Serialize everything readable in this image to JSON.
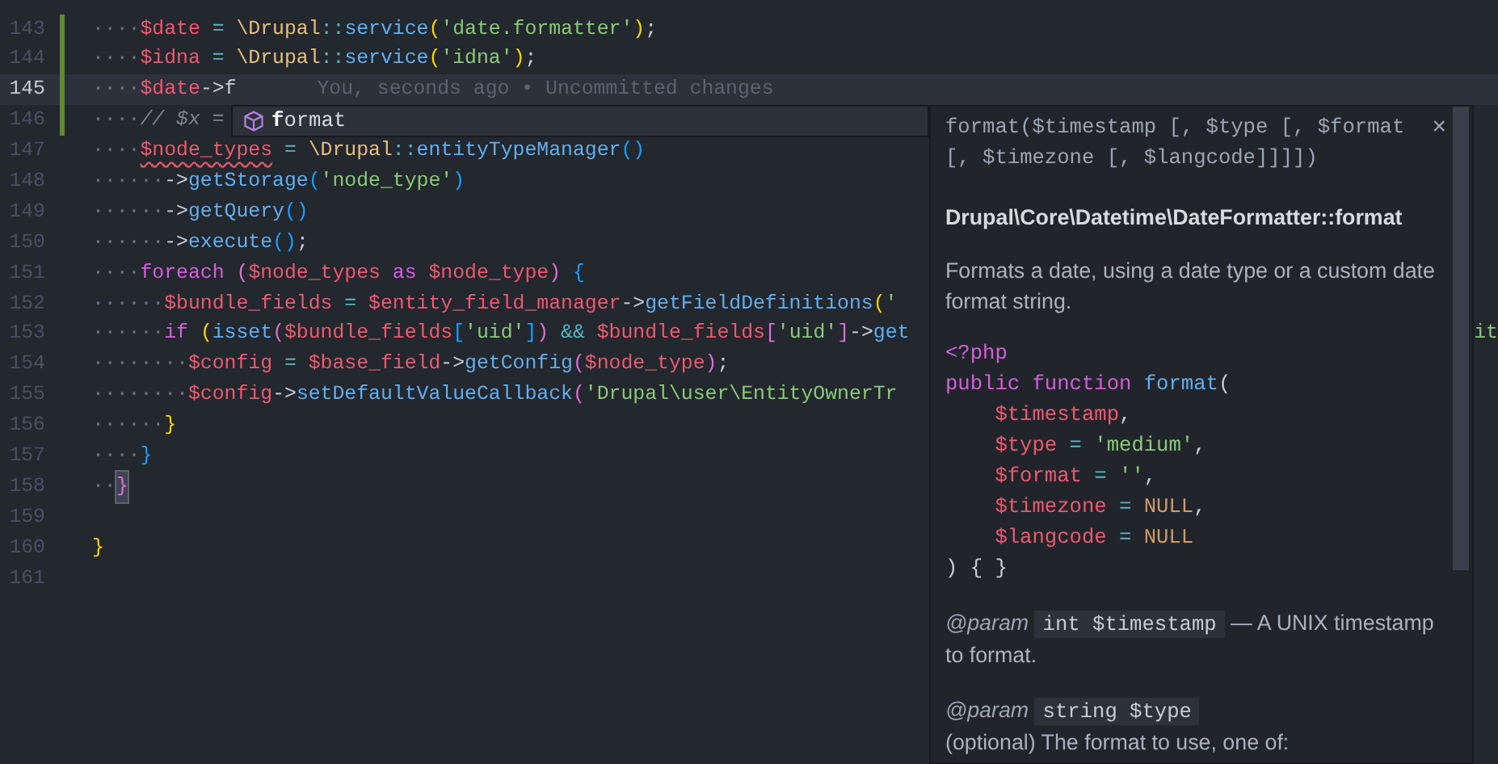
{
  "editor": {
    "lines": [
      {
        "number": "143",
        "modified": true,
        "tokens": [
          {
            "text": "····",
            "kind": "ws"
          },
          {
            "text": "$date",
            "kind": "var"
          },
          {
            "text": " = ",
            "kind": "op"
          },
          {
            "text": "\\Drupal",
            "kind": "cls"
          },
          {
            "text": "::",
            "kind": "op"
          },
          {
            "text": "service",
            "kind": "fn"
          },
          {
            "text": "(",
            "kind": "b1"
          },
          {
            "text": "'date.formatter'",
            "kind": "str"
          },
          {
            "text": ")",
            "kind": "b1"
          },
          {
            "text": ";",
            "kind": "punc"
          }
        ]
      },
      {
        "number": "144",
        "modified": true,
        "tokens": [
          {
            "text": "····",
            "kind": "ws"
          },
          {
            "text": "$idna",
            "kind": "var"
          },
          {
            "text": " = ",
            "kind": "op"
          },
          {
            "text": "\\Drupal",
            "kind": "cls"
          },
          {
            "text": "::",
            "kind": "op"
          },
          {
            "text": "service",
            "kind": "fn"
          },
          {
            "text": "(",
            "kind": "b1"
          },
          {
            "text": "'idna'",
            "kind": "str"
          },
          {
            "text": ")",
            "kind": "b1"
          },
          {
            "text": ";",
            "kind": "punc"
          }
        ]
      },
      {
        "number": "145",
        "modified": true,
        "current": true,
        "tokens": [
          {
            "text": "····",
            "kind": "ws"
          },
          {
            "text": "$date",
            "kind": "var"
          },
          {
            "text": "->f",
            "kind": "punc"
          }
        ],
        "annotation": "You, seconds ago • Uncommitted changes"
      },
      {
        "number": "146",
        "modified": true,
        "tokens": [
          {
            "text": "····",
            "kind": "ws"
          },
          {
            "text": "// $x =",
            "kind": "comment"
          }
        ]
      },
      {
        "number": "147",
        "tokens": [
          {
            "text": "····",
            "kind": "ws"
          },
          {
            "text": "$node_types",
            "kind": "var-error"
          },
          {
            "text": " = ",
            "kind": "op"
          },
          {
            "text": "\\Drupal",
            "kind": "cls"
          },
          {
            "text": "::",
            "kind": "op"
          },
          {
            "text": "entityTypeManager",
            "kind": "fn"
          },
          {
            "text": "()",
            "kind": "b3"
          }
        ]
      },
      {
        "number": "148",
        "tokens": [
          {
            "text": "······",
            "kind": "ws"
          },
          {
            "text": "->",
            "kind": "punc"
          },
          {
            "text": "getStorage",
            "kind": "fn"
          },
          {
            "text": "(",
            "kind": "b3"
          },
          {
            "text": "'node_type'",
            "kind": "str"
          },
          {
            "text": ")",
            "kind": "b3"
          }
        ]
      },
      {
        "number": "149",
        "tokens": [
          {
            "text": "······",
            "kind": "ws"
          },
          {
            "text": "->",
            "kind": "punc"
          },
          {
            "text": "getQuery",
            "kind": "fn"
          },
          {
            "text": "()",
            "kind": "b3"
          }
        ]
      },
      {
        "number": "150",
        "tokens": [
          {
            "text": "······",
            "kind": "ws"
          },
          {
            "text": "->",
            "kind": "punc"
          },
          {
            "text": "execute",
            "kind": "fn"
          },
          {
            "text": "()",
            "kind": "b3"
          },
          {
            "text": ";",
            "kind": "punc"
          }
        ]
      },
      {
        "number": "151",
        "tokens": [
          {
            "text": "····",
            "kind": "ws"
          },
          {
            "text": "foreach ",
            "kind": "kw"
          },
          {
            "text": "(",
            "kind": "b2"
          },
          {
            "text": "$node_types",
            "kind": "var"
          },
          {
            "text": " as ",
            "kind": "kw"
          },
          {
            "text": "$node_type",
            "kind": "var"
          },
          {
            "text": ")",
            "kind": "b2"
          },
          {
            "text": " {",
            "kind": "b3"
          }
        ]
      },
      {
        "number": "152",
        "tokens": [
          {
            "text": "······",
            "kind": "ws"
          },
          {
            "text": "$bundle_fields",
            "kind": "var"
          },
          {
            "text": " = ",
            "kind": "op"
          },
          {
            "text": "$entity_field_manager",
            "kind": "var"
          },
          {
            "text": "->",
            "kind": "punc"
          },
          {
            "text": "getFieldDefinitions",
            "kind": "fn"
          },
          {
            "text": "(",
            "kind": "b1"
          },
          {
            "text": "'",
            "kind": "str"
          }
        ]
      },
      {
        "number": "153",
        "tokens": [
          {
            "text": "······",
            "kind": "ws"
          },
          {
            "text": "if ",
            "kind": "kw"
          },
          {
            "text": "(",
            "kind": "b1"
          },
          {
            "text": "isset",
            "kind": "fn"
          },
          {
            "text": "(",
            "kind": "b2"
          },
          {
            "text": "$bundle_fields",
            "kind": "var"
          },
          {
            "text": "[",
            "kind": "b3"
          },
          {
            "text": "'uid'",
            "kind": "str"
          },
          {
            "text": "]",
            "kind": "b3"
          },
          {
            "text": ")",
            "kind": "b2"
          },
          {
            "text": " && ",
            "kind": "op"
          },
          {
            "text": "$bundle_fields",
            "kind": "var"
          },
          {
            "text": "[",
            "kind": "b2"
          },
          {
            "text": "'uid'",
            "kind": "str"
          },
          {
            "text": "]",
            "kind": "b2"
          },
          {
            "text": "->",
            "kind": "punc"
          },
          {
            "text": "get",
            "kind": "fn"
          }
        ],
        "tail": "it"
      },
      {
        "number": "154",
        "tokens": [
          {
            "text": "········",
            "kind": "ws"
          },
          {
            "text": "$config",
            "kind": "var"
          },
          {
            "text": " = ",
            "kind": "op"
          },
          {
            "text": "$base_field",
            "kind": "var"
          },
          {
            "text": "->",
            "kind": "punc"
          },
          {
            "text": "getConfig",
            "kind": "fn"
          },
          {
            "text": "(",
            "kind": "b2"
          },
          {
            "text": "$node_type",
            "kind": "var"
          },
          {
            "text": ")",
            "kind": "b2"
          },
          {
            "text": ";",
            "kind": "punc"
          }
        ]
      },
      {
        "number": "155",
        "tokens": [
          {
            "text": "········",
            "kind": "ws"
          },
          {
            "text": "$config",
            "kind": "var"
          },
          {
            "text": "->",
            "kind": "punc"
          },
          {
            "text": "setDefaultValueCallback",
            "kind": "fn"
          },
          {
            "text": "(",
            "kind": "b2"
          },
          {
            "text": "'Drupal\\user\\EntityOwnerTr",
            "kind": "str"
          }
        ]
      },
      {
        "number": "156",
        "tokens": [
          {
            "text": "······",
            "kind": "ws"
          },
          {
            "text": "}",
            "kind": "b1"
          }
        ]
      },
      {
        "number": "157",
        "tokens": [
          {
            "text": "····",
            "kind": "ws"
          },
          {
            "text": "}",
            "kind": "b3"
          }
        ]
      },
      {
        "number": "158",
        "tokens": [
          {
            "text": "··",
            "kind": "ws"
          },
          {
            "text": "}",
            "kind": "b2-match"
          }
        ]
      },
      {
        "number": "159"
      },
      {
        "number": "160",
        "tokens": [
          {
            "text": "}",
            "kind": "b1"
          }
        ]
      },
      {
        "number": "161"
      }
    ]
  },
  "suggest": {
    "items": [
      {
        "label": "**f**ormat"
      }
    ]
  },
  "hover": {
    "signature": "format($timestamp [, $type [, $format [, $timezone [, $langcode]]]])",
    "close": "×",
    "title": "Drupal\\Core\\Datetime\\DateFormatter::format",
    "description": "Formats a date, using a date type or a custom date format string.",
    "code": [
      {
        "tokens": [
          {
            "text": "<?php",
            "kind": "kw"
          }
        ]
      },
      {
        "tokens": [
          {
            "text": "public function ",
            "kind": "kw"
          },
          {
            "text": "format",
            "kind": "fn"
          },
          {
            "text": "(",
            "kind": "punc"
          }
        ]
      },
      {
        "indent": true,
        "tokens": [
          {
            "text": "$timestamp",
            "kind": "var"
          },
          {
            "text": ",",
            "kind": "punc"
          }
        ]
      },
      {
        "indent": true,
        "tokens": [
          {
            "text": "$type",
            "kind": "var"
          },
          {
            "text": " = ",
            "kind": "op"
          },
          {
            "text": "'medium'",
            "kind": "str"
          },
          {
            "text": ",",
            "kind": "punc"
          }
        ]
      },
      {
        "indent": true,
        "tokens": [
          {
            "text": "$format",
            "kind": "var"
          },
          {
            "text": " = ",
            "kind": "op"
          },
          {
            "text": "''",
            "kind": "str"
          },
          {
            "text": ",",
            "kind": "punc"
          }
        ]
      },
      {
        "indent": true,
        "tokens": [
          {
            "text": "$timezone",
            "kind": "var"
          },
          {
            "text": " = ",
            "kind": "op"
          },
          {
            "text": "NULL",
            "kind": "const"
          },
          {
            "text": ",",
            "kind": "punc"
          }
        ]
      },
      {
        "indent": true,
        "tokens": [
          {
            "text": "$langcode",
            "kind": "var"
          },
          {
            "text": " = ",
            "kind": "op"
          },
          {
            "text": "NULL",
            "kind": "const"
          }
        ]
      },
      {
        "tokens": [
          {
            "text": ") { }",
            "kind": "punc"
          }
        ]
      }
    ],
    "params": [
      {
        "tag": "@param",
        "code": "int $timestamp",
        "text": "— A UNIX timestamp to format.",
        "text_on_new_line": false
      },
      {
        "tag": "@param",
        "code": "string $type",
        "text": "(optional) The format to use, one of:",
        "text_on_new_line": true
      }
    ]
  }
}
